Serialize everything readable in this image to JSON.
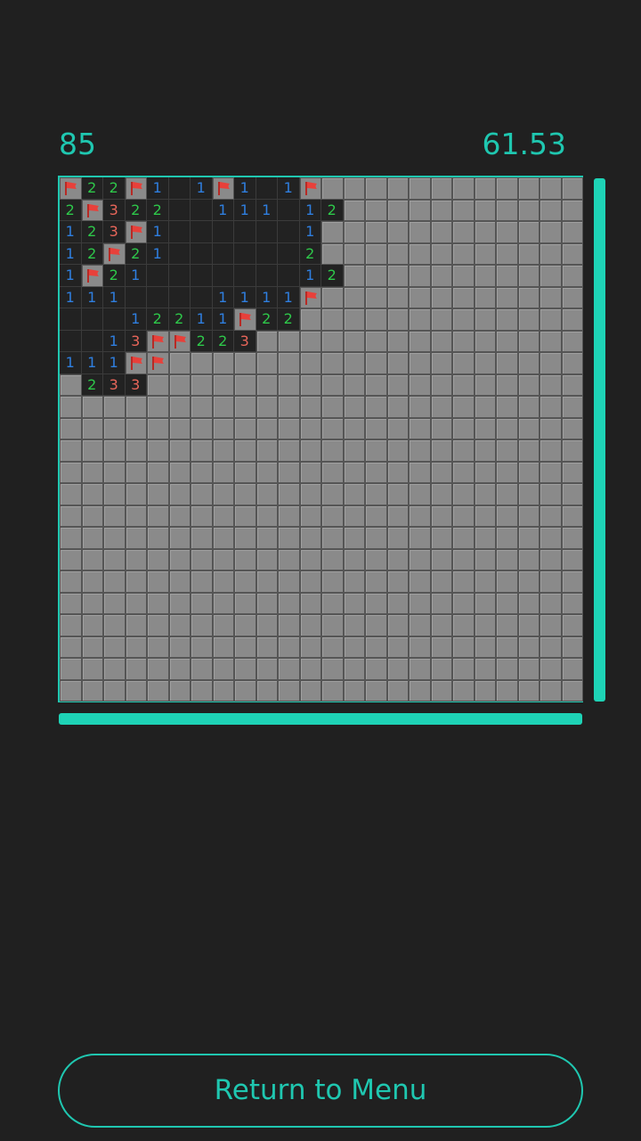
{
  "header": {
    "mines_left": "85",
    "timer": "61.53"
  },
  "colors": {
    "accent": "#1fc7b0",
    "background": "#202020",
    "hidden_cell": "#8a8a8a",
    "revealed_cell": "#222222",
    "num1": "#2f7fe0",
    "num2": "#2ec84a",
    "num3": "#e9665a",
    "flag": "#e8403a"
  },
  "board": {
    "columns": 24,
    "visible_rows": 24,
    "legend": "F = flag icon, H = hidden, . = revealed empty, digit = number",
    "revealed_rows": [
      "F22F1.1F1.1F",
      "2F322..111.12",
      "123F1......1",
      "12F21......2",
      "1F21.......12",
      "111....1111F",
      "...12211F22",
      "..13FF223",
      "111FF",
      "H233"
    ]
  },
  "scrollbars": {
    "vertical_icon": "vertical-scrollbar",
    "horizontal_icon": "horizontal-scrollbar"
  },
  "footer": {
    "return_label": "Return to Menu"
  }
}
